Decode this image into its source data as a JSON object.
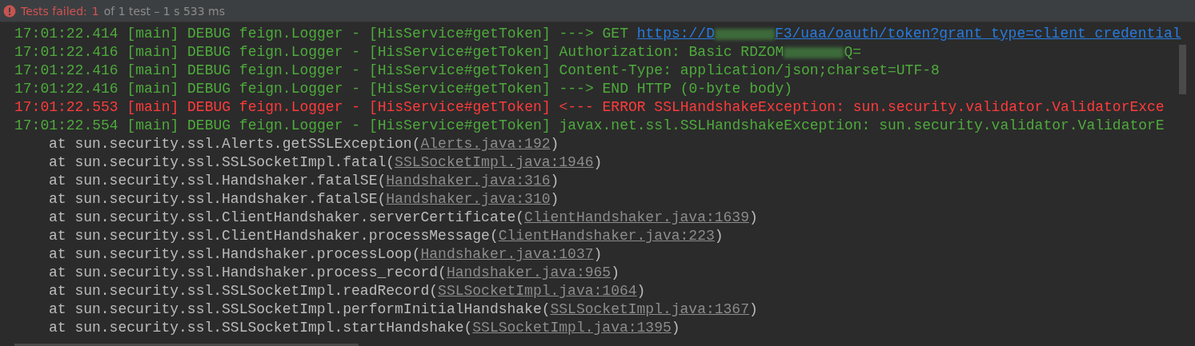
{
  "status_bar": {
    "label": "Tests failed:",
    "failed": "1",
    "summary": "of 1 test – 1 s 533 ms"
  },
  "console": [
    {
      "kind": "log",
      "error": false,
      "time": "17:01:22.414",
      "thread": "[main]",
      "level": "DEBUG",
      "logger": "feign.Logger",
      "separator": "-",
      "tag": "[HisService#getToken]",
      "message": [
        {
          "kind": "text",
          "text": "---> GET "
        },
        {
          "kind": "link",
          "text": "https://D"
        },
        {
          "kind": "redacted"
        },
        {
          "kind": "link",
          "text": "F3/uaa/oauth/token?grant_type=client_credential"
        }
      ]
    },
    {
      "kind": "log",
      "error": false,
      "time": "17:01:22.416",
      "thread": "[main]",
      "level": "DEBUG",
      "logger": "feign.Logger",
      "separator": "-",
      "tag": "[HisService#getToken]",
      "message": [
        {
          "kind": "text",
          "text": "Authorization: Basic RDZOM"
        },
        {
          "kind": "redacted"
        },
        {
          "kind": "text",
          "text": "Q="
        }
      ]
    },
    {
      "kind": "log",
      "error": false,
      "time": "17:01:22.416",
      "thread": "[main]",
      "level": "DEBUG",
      "logger": "feign.Logger",
      "separator": "-",
      "tag": "[HisService#getToken]",
      "message": [
        {
          "kind": "text",
          "text": "Content-Type: application/json;charset=UTF-8"
        }
      ]
    },
    {
      "kind": "log",
      "error": false,
      "time": "17:01:22.416",
      "thread": "[main]",
      "level": "DEBUG",
      "logger": "feign.Logger",
      "separator": "-",
      "tag": "[HisService#getToken]",
      "message": [
        {
          "kind": "text",
          "text": "---> END HTTP (0-byte body)"
        }
      ]
    },
    {
      "kind": "log",
      "error": true,
      "time": "17:01:22.553",
      "thread": "[main]",
      "level": "DEBUG",
      "logger": "feign.Logger",
      "separator": "-",
      "tag": "[HisService#getToken]",
      "message": [
        {
          "kind": "text",
          "text": "<--- ERROR SSLHandshakeException: sun.security.validator.ValidatorExce"
        }
      ]
    },
    {
      "kind": "log",
      "error": false,
      "time": "17:01:22.554",
      "thread": "[main]",
      "level": "DEBUG",
      "logger": "feign.Logger",
      "separator": "-",
      "tag": "[HisService#getToken]",
      "message": [
        {
          "kind": "text",
          "text": "javax.net.ssl.SSLHandshakeException: sun.security.validator.ValidatorE"
        }
      ]
    },
    {
      "kind": "stack",
      "at": "at",
      "method": "sun.security.ssl.Alerts.getSSLException(",
      "source": "Alerts.java:192",
      "close": ")"
    },
    {
      "kind": "stack",
      "at": "at",
      "method": "sun.security.ssl.SSLSocketImpl.fatal(",
      "source": "SSLSocketImpl.java:1946",
      "close": ")"
    },
    {
      "kind": "stack",
      "at": "at",
      "method": "sun.security.ssl.Handshaker.fatalSE(",
      "source": "Handshaker.java:316",
      "close": ")"
    },
    {
      "kind": "stack",
      "at": "at",
      "method": "sun.security.ssl.Handshaker.fatalSE(",
      "source": "Handshaker.java:310",
      "close": ")"
    },
    {
      "kind": "stack",
      "at": "at",
      "method": "sun.security.ssl.ClientHandshaker.serverCertificate(",
      "source": "ClientHandshaker.java:1639",
      "close": ")"
    },
    {
      "kind": "stack",
      "at": "at",
      "method": "sun.security.ssl.ClientHandshaker.processMessage(",
      "source": "ClientHandshaker.java:223",
      "close": ")"
    },
    {
      "kind": "stack",
      "at": "at",
      "method": "sun.security.ssl.Handshaker.processLoop(",
      "source": "Handshaker.java:1037",
      "close": ")"
    },
    {
      "kind": "stack",
      "at": "at",
      "method": "sun.security.ssl.Handshaker.process_record(",
      "source": "Handshaker.java:965",
      "close": ")"
    },
    {
      "kind": "stack",
      "at": "at",
      "method": "sun.security.ssl.SSLSocketImpl.readRecord(",
      "source": "SSLSocketImpl.java:1064",
      "close": ")"
    },
    {
      "kind": "stack",
      "at": "at",
      "method": "sun.security.ssl.SSLSocketImpl.performInitialHandshake(",
      "source": "SSLSocketImpl.java:1367",
      "close": ")"
    },
    {
      "kind": "stack",
      "at": "at",
      "method": "sun.security.ssl.SSLSocketImpl.startHandshake(",
      "source": "SSLSocketImpl.java:1395",
      "close": ")"
    }
  ]
}
